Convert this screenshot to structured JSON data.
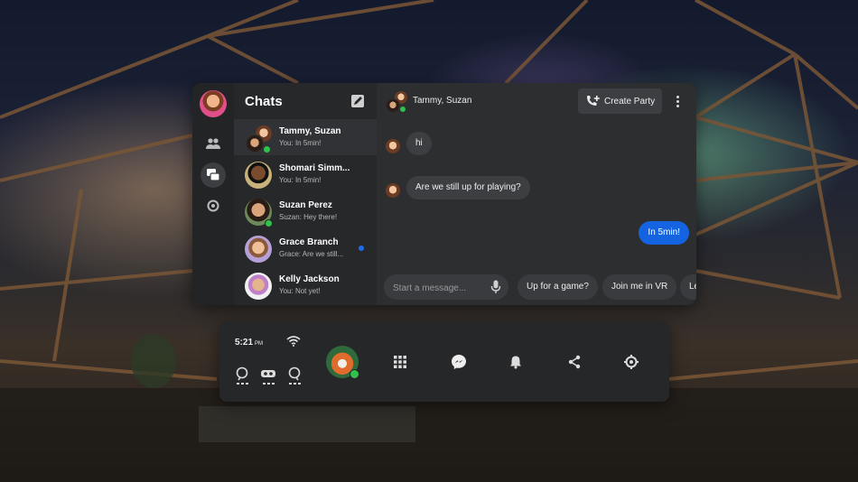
{
  "chats_panel": {
    "title": "Chats",
    "conversations": [
      {
        "name": "Tammy, Suzan",
        "preview": "You: In 5min!",
        "selected": true,
        "online": true
      },
      {
        "name": "Shomari Simm...",
        "preview": "You: In 5min!"
      },
      {
        "name": "Suzan Perez",
        "preview": "Suzan: Hey there!",
        "online": true
      },
      {
        "name": "Grace Branch",
        "preview": "Grace: Are we still...",
        "unread": true
      },
      {
        "name": "Kelly Jackson",
        "preview": "You: Not yet!"
      }
    ]
  },
  "thread": {
    "title": "Tammy, Suzan",
    "create_party_label": "Create Party",
    "messages": [
      {
        "text": "hi",
        "direction": "incoming"
      },
      {
        "text": "Are we still up for playing?",
        "direction": "incoming"
      },
      {
        "text": "In 5min!",
        "direction": "outgoing"
      }
    ],
    "composer_placeholder": "Start a message...",
    "quick_replies": [
      "Up for a game?",
      "Join me in VR",
      "Le"
    ]
  },
  "dock": {
    "time": "5:21",
    "ampm": "PM",
    "icons": [
      "apps-grid-icon",
      "messenger-icon",
      "bell-icon",
      "share-icon",
      "settings-icon"
    ]
  },
  "colors": {
    "accent": "#1463e0",
    "online": "#31c24d",
    "panel": "#2a2b2d"
  }
}
